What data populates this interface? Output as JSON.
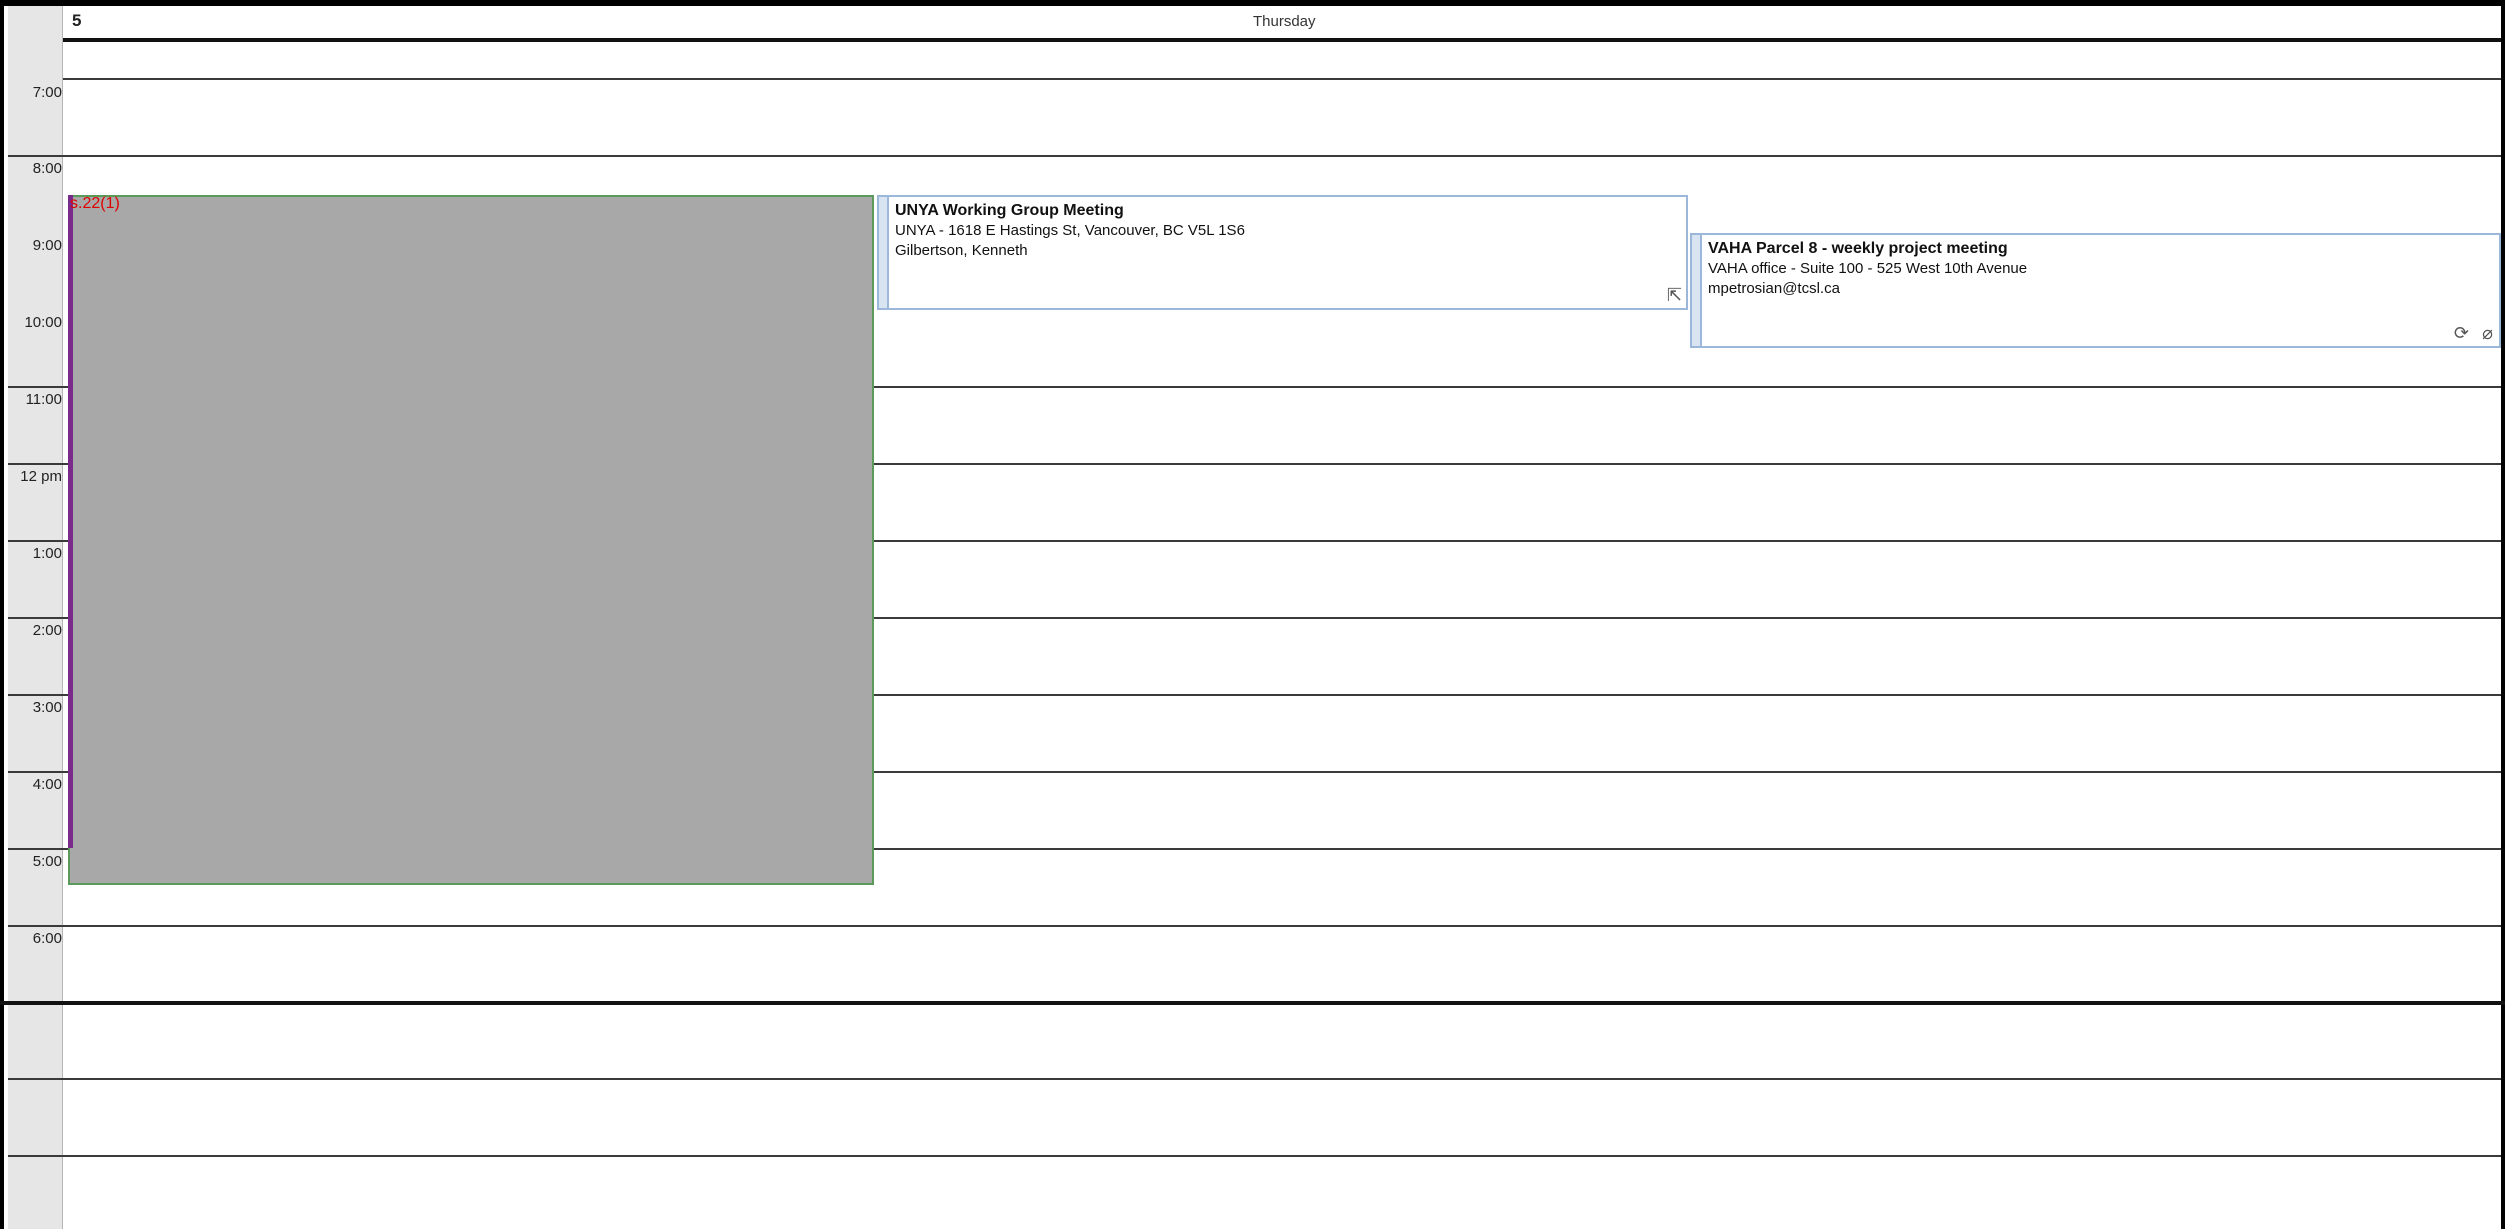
{
  "header": {
    "day_number": "5",
    "day_name": "Thursday"
  },
  "time_slots": [
    "7:00",
    "8:00",
    "9:00",
    "10:00",
    "11:00",
    "12 pm",
    "1:00",
    "2:00",
    "3:00",
    "4:00",
    "5:00",
    "6:00"
  ],
  "busy_block": {
    "label": "s.22(1)"
  },
  "appointments": [
    {
      "title": "UNYA Working Group Meeting",
      "location": "UNYA -  1618 E Hastings St, Vancouver, BC V5L 1S6",
      "organizer": "Gilbertson, Kenneth",
      "icons": [
        "forwarded-meeting-icon"
      ]
    },
    {
      "title": "VAHA Parcel 8 - weekly project meeting",
      "location": "VAHA office - Suite 100 - 525 West 10th Avenue",
      "organizer": "mpetrosian@tcsl.ca",
      "icons": [
        "recurring-icon",
        "attachment-icon"
      ]
    }
  ]
}
